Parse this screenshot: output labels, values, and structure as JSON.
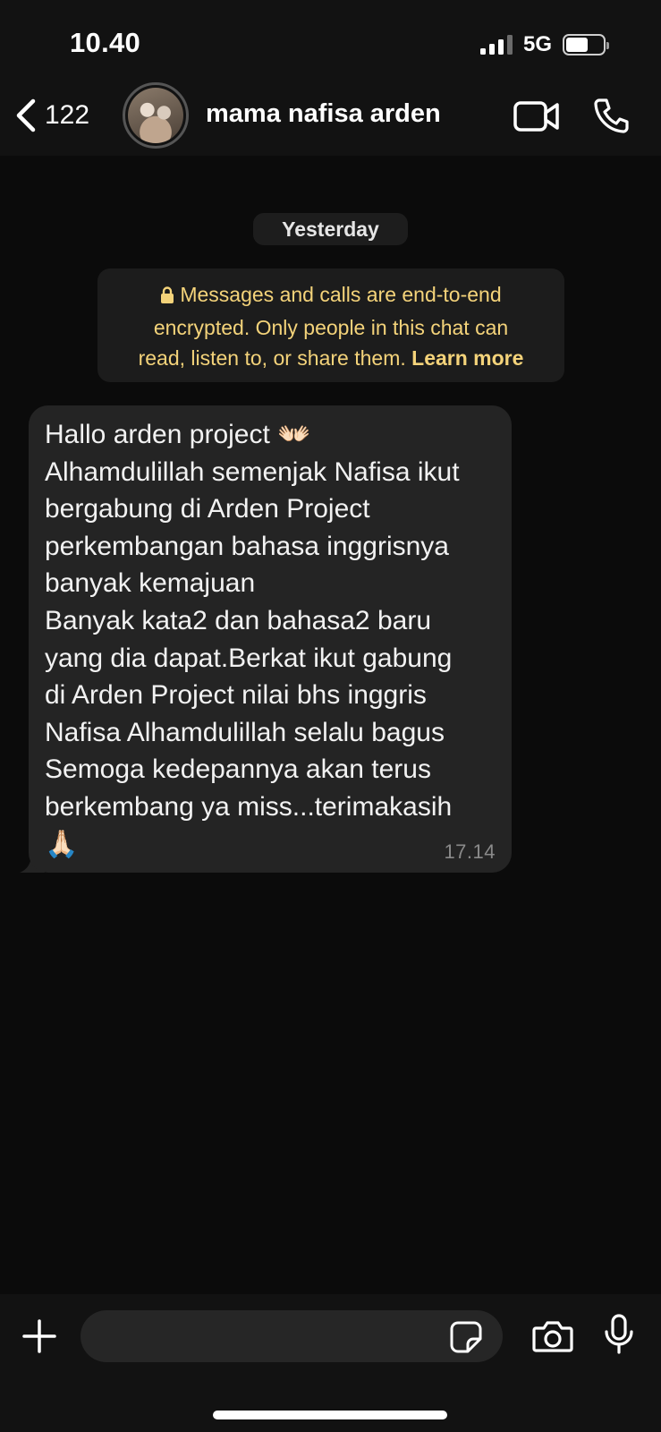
{
  "status_bar": {
    "time": "10.40",
    "network": "5G",
    "battery_level": 0.6
  },
  "header": {
    "back_count": "122",
    "contact_name": "mama nafisa arden"
  },
  "chat": {
    "date_label": "Yesterday",
    "encryption": {
      "line1": "Messages and calls are end-to-end",
      "line2": "encrypted. Only people in this chat can",
      "line3": "read, listen to, or share them.",
      "learn_more": "Learn more"
    },
    "message": {
      "lines": [
        "Hallo arden project 👐🏻",
        "Alhamdulillah semenjak Nafisa ikut",
        "bergabung di Arden Project",
        "perkembangan bahasa inggrisnya",
        "banyak kemajuan",
        "Banyak kata2 dan bahasa2 baru",
        "yang dia dapat.Berkat ikut gabung",
        "di Arden Project nilai bhs inggris",
        "Nafisa Alhamdulillah selalu bagus",
        "Semoga kedepannya akan terus",
        "berkembang ya miss...terimakasih",
        "🙏🏻"
      ],
      "time": "17.14"
    }
  },
  "composer": {
    "placeholder": ""
  },
  "icons": {
    "back": "chevron-left-icon",
    "video": "video-camera-icon",
    "call": "phone-icon",
    "lock": "lock-icon",
    "plus": "plus-icon",
    "sticker": "sticker-icon",
    "camera": "camera-icon",
    "mic": "microphone-icon"
  },
  "colors": {
    "background": "#0b0b0b",
    "bar": "#121212",
    "bubble": "#242424",
    "encryption_text": "#f4d37a"
  }
}
